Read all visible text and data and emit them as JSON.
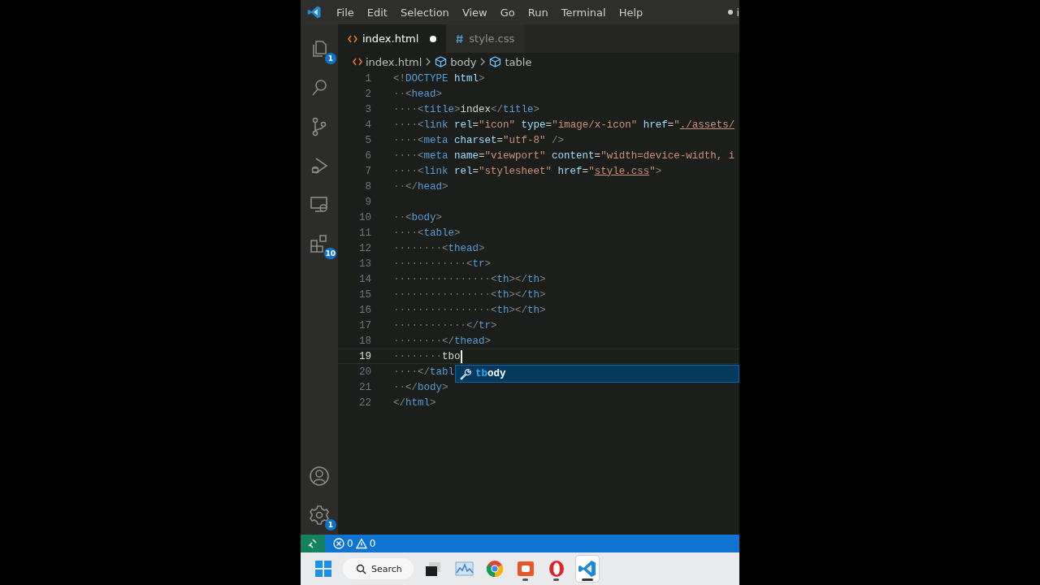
{
  "menu": [
    "File",
    "Edit",
    "Selection",
    "View",
    "Go",
    "Run",
    "Terminal",
    "Help"
  ],
  "title": {
    "text": "i",
    "modified": true
  },
  "activity_bar": {
    "top": [
      {
        "kind": "files",
        "badge": "1"
      },
      {
        "kind": "search"
      },
      {
        "kind": "source-control"
      },
      {
        "kind": "run-debug"
      },
      {
        "kind": "remote"
      },
      {
        "kind": "extensions",
        "badge": "10"
      }
    ],
    "bottom": [
      {
        "kind": "account"
      },
      {
        "kind": "settings",
        "badge": "1"
      }
    ]
  },
  "tabs": [
    {
      "label": "index.html",
      "kind": "html",
      "selected": true,
      "modified": true
    },
    {
      "label": "style.css",
      "kind": "css",
      "selected": false,
      "modified": false
    }
  ],
  "breadcrumb": [
    {
      "label": "index.html",
      "kind": "html"
    },
    {
      "label": "body",
      "kind": "element"
    },
    {
      "label": "table",
      "kind": "element"
    }
  ],
  "lines": [
    {
      "number": "1",
      "current": false,
      "tokens": [
        {
          "kind": "punct",
          "text": "<!"
        },
        {
          "kind": "tag",
          "text": "DOCTYPE"
        },
        {
          "kind": "attr",
          "text": " html"
        },
        {
          "kind": "punct",
          "text": ">"
        }
      ]
    },
    {
      "number": "2",
      "indent": "··",
      "current": false,
      "tokens": [
        {
          "kind": "punct",
          "text": "<"
        },
        {
          "kind": "tag",
          "text": "head"
        },
        {
          "kind": "punct",
          "text": ">"
        }
      ]
    },
    {
      "number": "3",
      "indent": "····",
      "current": false,
      "tokens": [
        {
          "kind": "punct",
          "text": "<"
        },
        {
          "kind": "tag",
          "text": "title"
        },
        {
          "kind": "punct",
          "text": ">"
        },
        {
          "kind": "text",
          "text": "index"
        },
        {
          "kind": "punct",
          "text": "</"
        },
        {
          "kind": "tag",
          "text": "title"
        },
        {
          "kind": "punct",
          "text": ">"
        }
      ]
    },
    {
      "number": "4",
      "indent": "····",
      "current": false,
      "tokens": [
        {
          "kind": "punct",
          "text": "<"
        },
        {
          "kind": "tag",
          "text": "link"
        },
        {
          "kind": "attr",
          "text": " rel"
        },
        {
          "kind": "text",
          "text": "="
        },
        {
          "kind": "str",
          "text": "\"icon\""
        },
        {
          "kind": "attr",
          "text": " type"
        },
        {
          "kind": "text",
          "text": "="
        },
        {
          "kind": "str",
          "text": "\"image/x-icon\""
        },
        {
          "kind": "attr",
          "text": " href"
        },
        {
          "kind": "text",
          "text": "="
        },
        {
          "kind": "str",
          "text": "\""
        },
        {
          "kind": "link",
          "text": "./assets/"
        }
      ]
    },
    {
      "number": "5",
      "indent": "····",
      "current": false,
      "tokens": [
        {
          "kind": "punct",
          "text": "<"
        },
        {
          "kind": "tag",
          "text": "meta"
        },
        {
          "kind": "attr",
          "text": " charset"
        },
        {
          "kind": "text",
          "text": "="
        },
        {
          "kind": "str",
          "text": "\"utf-8\""
        },
        {
          "kind": "punct",
          "text": " />"
        }
      ]
    },
    {
      "number": "6",
      "indent": "····",
      "current": false,
      "tokens": [
        {
          "kind": "punct",
          "text": "<"
        },
        {
          "kind": "tag",
          "text": "meta"
        },
        {
          "kind": "attr",
          "text": " name"
        },
        {
          "kind": "text",
          "text": "="
        },
        {
          "kind": "str",
          "text": "\"viewport\""
        },
        {
          "kind": "attr",
          "text": " content"
        },
        {
          "kind": "text",
          "text": "="
        },
        {
          "kind": "str",
          "text": "\"width=device-width, i"
        }
      ]
    },
    {
      "number": "7",
      "indent": "····",
      "current": false,
      "tokens": [
        {
          "kind": "punct",
          "text": "<"
        },
        {
          "kind": "tag",
          "text": "link"
        },
        {
          "kind": "attr",
          "text": " rel"
        },
        {
          "kind": "text",
          "text": "="
        },
        {
          "kind": "str",
          "text": "\"stylesheet\""
        },
        {
          "kind": "attr",
          "text": " href"
        },
        {
          "kind": "text",
          "text": "="
        },
        {
          "kind": "str",
          "text": "\""
        },
        {
          "kind": "link",
          "text": "style.css"
        },
        {
          "kind": "str",
          "text": "\""
        },
        {
          "kind": "punct",
          "text": ">"
        }
      ]
    },
    {
      "number": "8",
      "indent": "··",
      "current": false,
      "tokens": [
        {
          "kind": "punct",
          "text": "</"
        },
        {
          "kind": "tag",
          "text": "head"
        },
        {
          "kind": "punct",
          "text": ">"
        }
      ]
    },
    {
      "number": "9",
      "current": false
    },
    {
      "number": "10",
      "indent": "··",
      "current": false,
      "tokens": [
        {
          "kind": "punct",
          "text": "<"
        },
        {
          "kind": "tag",
          "text": "body"
        },
        {
          "kind": "punct",
          "text": ">"
        }
      ]
    },
    {
      "number": "11",
      "indent": "····",
      "current": false,
      "tokens": [
        {
          "kind": "punct",
          "text": "<"
        },
        {
          "kind": "tag",
          "text": "table"
        },
        {
          "kind": "punct",
          "text": ">"
        }
      ]
    },
    {
      "number": "12",
      "indent": "········",
      "current": false,
      "tokens": [
        {
          "kind": "punct",
          "text": "<"
        },
        {
          "kind": "tag",
          "text": "thead"
        },
        {
          "kind": "punct",
          "text": ">"
        }
      ]
    },
    {
      "number": "13",
      "indent": "············",
      "current": false,
      "tokens": [
        {
          "kind": "punct",
          "text": "<"
        },
        {
          "kind": "tag",
          "text": "tr"
        },
        {
          "kind": "punct",
          "text": ">"
        }
      ]
    },
    {
      "number": "14",
      "indent": "················",
      "current": false,
      "tokens": [
        {
          "kind": "punct",
          "text": "<"
        },
        {
          "kind": "tag",
          "text": "th"
        },
        {
          "kind": "punct",
          "text": "></"
        },
        {
          "kind": "tag",
          "text": "th"
        },
        {
          "kind": "punct",
          "text": ">"
        }
      ]
    },
    {
      "number": "15",
      "indent": "················",
      "current": false,
      "tokens": [
        {
          "kind": "punct",
          "text": "<"
        },
        {
          "kind": "tag",
          "text": "th"
        },
        {
          "kind": "punct",
          "text": "></"
        },
        {
          "kind": "tag",
          "text": "th"
        },
        {
          "kind": "punct",
          "text": ">"
        }
      ]
    },
    {
      "number": "16",
      "indent": "················",
      "current": false,
      "tokens": [
        {
          "kind": "punct",
          "text": "<"
        },
        {
          "kind": "tag",
          "text": "th"
        },
        {
          "kind": "punct",
          "text": "></"
        },
        {
          "kind": "tag",
          "text": "th"
        },
        {
          "kind": "punct",
          "text": ">"
        }
      ]
    },
    {
      "number": "17",
      "indent": "············",
      "current": false,
      "tokens": [
        {
          "kind": "punct",
          "text": "</"
        },
        {
          "kind": "tag",
          "text": "tr"
        },
        {
          "kind": "punct",
          "text": ">"
        }
      ]
    },
    {
      "number": "18",
      "indent": "········",
      "current": false,
      "tokens": [
        {
          "kind": "punct",
          "text": "</"
        },
        {
          "kind": "tag",
          "text": "thead"
        },
        {
          "kind": "punct",
          "text": ">"
        }
      ]
    },
    {
      "number": "19",
      "indent": "········",
      "current": true,
      "tokens": [
        {
          "kind": "text",
          "text": "tbo"
        }
      ]
    },
    {
      "number": "20",
      "indent": "····",
      "current": false,
      "tokens": [
        {
          "kind": "punct",
          "text": "</"
        },
        {
          "kind": "tag",
          "text": "tabl"
        }
      ]
    },
    {
      "number": "21",
      "indent": "··",
      "current": false,
      "tokens": [
        {
          "kind": "punct",
          "text": "</"
        },
        {
          "kind": "tag",
          "text": "body"
        },
        {
          "kind": "punct",
          "text": ">"
        }
      ]
    },
    {
      "number": "22",
      "current": false,
      "tokens": [
        {
          "kind": "punct",
          "text": "</"
        },
        {
          "kind": "tag",
          "text": "html"
        },
        {
          "kind": "punct",
          "text": ">"
        }
      ]
    }
  ],
  "suggestion": {
    "match": "tb",
    "rest": "ody"
  },
  "status_bar": {
    "errors": "0",
    "warnings": "0"
  },
  "taskbar": [
    {
      "kind": "start",
      "running": false,
      "selected": false
    },
    {
      "kind": "search",
      "label": "Search"
    },
    {
      "kind": "task-view",
      "running": false,
      "selected": false
    },
    {
      "kind": "photos",
      "running": false,
      "selected": false
    },
    {
      "kind": "chrome",
      "running": false,
      "selected": false
    },
    {
      "kind": "recorder",
      "running": true,
      "selected": false
    },
    {
      "kind": "opera",
      "running": true,
      "selected": false
    },
    {
      "kind": "vscode",
      "running": true,
      "selected": true
    }
  ]
}
